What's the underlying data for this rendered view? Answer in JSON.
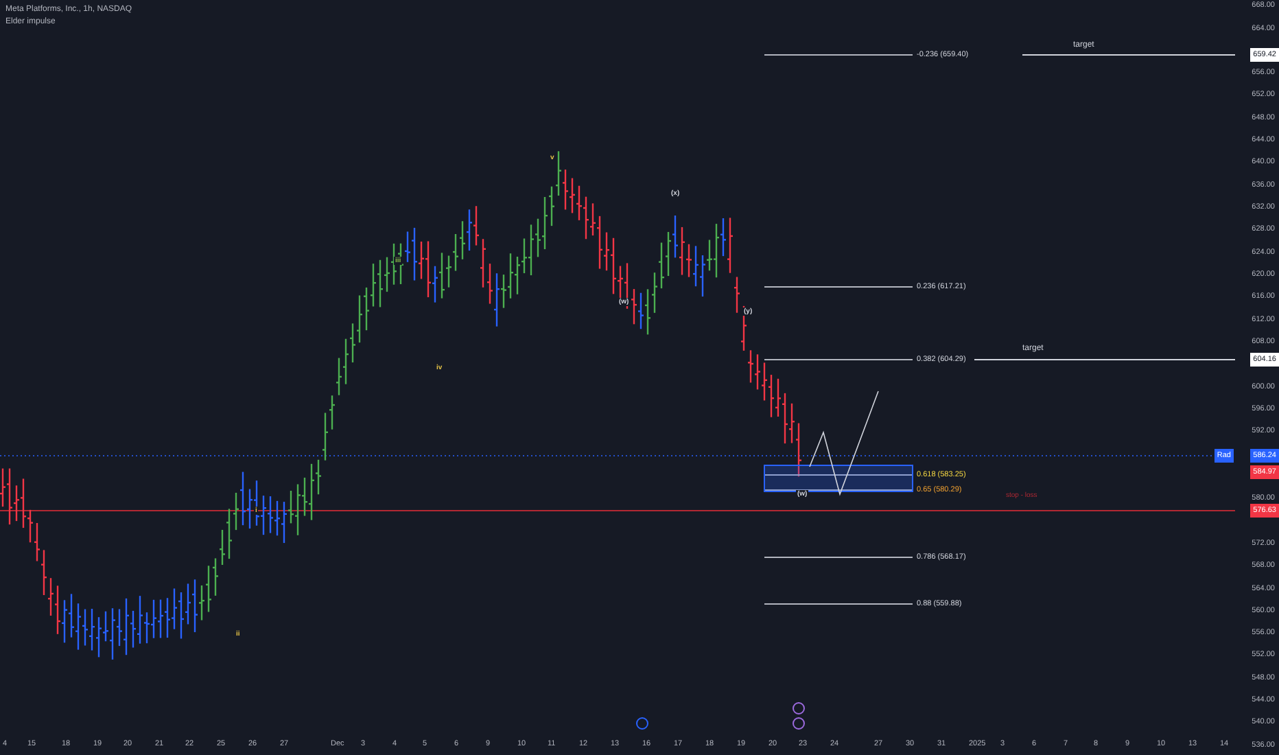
{
  "header": {
    "symbol": "Meta Platforms, Inc., 1h, NASDAQ",
    "indicator": "Elder impulse"
  },
  "price_axis": {
    "ticks": [
      "668.00",
      "664.00",
      "656.00",
      "652.00",
      "648.00",
      "644.00",
      "640.00",
      "636.00",
      "632.00",
      "628.00",
      "624.00",
      "620.00",
      "616.00",
      "612.00",
      "608.00",
      "600.00",
      "596.00",
      "592.00",
      "580.00",
      "572.00",
      "568.00",
      "564.00",
      "560.00",
      "556.00",
      "552.00",
      "548.00",
      "544.00",
      "540.00",
      "536.00"
    ],
    "markers": [
      {
        "text": "659.42",
        "kind": "level"
      },
      {
        "text": "604.16",
        "kind": "level"
      },
      {
        "text": "586.24",
        "kind": "last",
        "tag": "Rad"
      },
      {
        "text": "584.97",
        "kind": "down"
      },
      {
        "text": "576.63",
        "kind": "down"
      }
    ]
  },
  "time_axis": {
    "ticks": [
      "4",
      "15",
      "18",
      "19",
      "20",
      "21",
      "22",
      "25",
      "26",
      "27",
      "Dec",
      "3",
      "4",
      "5",
      "6",
      "9",
      "10",
      "11",
      "12",
      "13",
      "16",
      "17",
      "18",
      "19",
      "20",
      "23",
      "24",
      "27",
      "30",
      "31",
      "2025",
      "3",
      "6",
      "7",
      "8",
      "9",
      "10",
      "13",
      "14"
    ]
  },
  "fib_levels": [
    {
      "label": "-0.236 (659.40)",
      "color": "#d1d4dc"
    },
    {
      "label": "0.236 (617.21)",
      "color": "#d1d4dc"
    },
    {
      "label": "0.382 (604.29)",
      "color": "#d1d4dc"
    },
    {
      "label": "0.618 (583.25)",
      "color": "#f5d742"
    },
    {
      "label": "0.65 (580.29)",
      "color": "#f0a030"
    },
    {
      "label": "0.786 (568.17)",
      "color": "#d1d4dc"
    },
    {
      "label": "0.88 (559.88)",
      "color": "#d1d4dc"
    }
  ],
  "targets": [
    {
      "label": "target"
    },
    {
      "label": "target"
    }
  ],
  "stop_label": "stop - loss",
  "wave_labels": [
    {
      "text": "i",
      "color": "#e8c547"
    },
    {
      "text": "ii",
      "color": "#e8c547"
    },
    {
      "text": "iii",
      "color": "#8bc34a"
    },
    {
      "text": "iv",
      "color": "#e8c547"
    },
    {
      "text": "v",
      "color": "#e8c547"
    },
    {
      "text": "(w)",
      "color": "#d1d4dc"
    },
    {
      "text": "(x)",
      "color": "#d1d4dc"
    },
    {
      "text": "(y)",
      "color": "#d1d4dc"
    },
    {
      "text": "(w)",
      "color": "#d1d4dc"
    }
  ]
}
